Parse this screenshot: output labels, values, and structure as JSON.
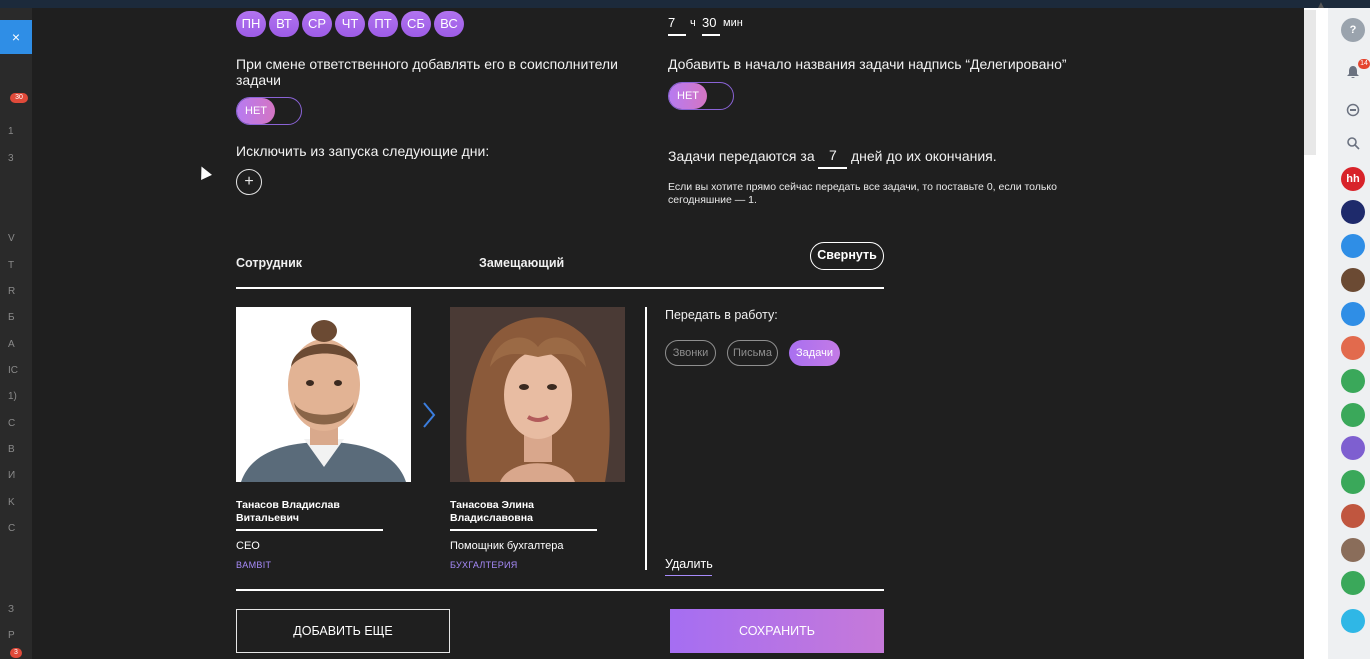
{
  "side": {
    "close_icon": "×",
    "letters": [
      "1",
      "3",
      "V",
      "T",
      "R",
      "Б",
      "A",
      "IC",
      "1)",
      "C",
      "B",
      "И",
      "K",
      "C",
      "З",
      "P"
    ],
    "badge_top": "30",
    "badge_bottom": "3"
  },
  "schedule": {
    "days": [
      "ПН",
      "ВТ",
      "СР",
      "ЧТ",
      "ПТ",
      "СБ",
      "ВС"
    ],
    "time_hours": "7",
    "hours_unit": "ч",
    "time_minutes": "30",
    "minutes_unit": "мин"
  },
  "settings": {
    "add_coexecutor_label": "При смене ответственного добавлять его в соисполнители задачи",
    "add_coexecutor_value": "НЕТ",
    "prefix_label": "Добавить в начало названия задачи надпись “Делегировано”",
    "prefix_value": "НЕТ",
    "exclude_days_label": "Исключить из запуска следующие дни:",
    "add_icon": "+",
    "days_before_prefix": "Задачи передаются за",
    "days_before_value": "7",
    "days_before_suffix": "дней до их окончания.",
    "note": "Если вы хотите прямо сейчас передать все задачи, то поставьте 0, если только сегодняшние — 1."
  },
  "table": {
    "employee_header": "Сотрудник",
    "substitute_header": "Замещающий",
    "collapse_label": "Свернуть"
  },
  "employee": {
    "name": "Танасов Владислав Витальевич",
    "role": "CEO",
    "department": "BAMBIT"
  },
  "substitute": {
    "name": "Танасова Элина Владиславовна",
    "role": "Помощник бухгалтера",
    "department": "БУХГАЛТЕРИЯ"
  },
  "transfer": {
    "label": "Передать в работу:",
    "chips": [
      {
        "label": "Звонки",
        "active": false
      },
      {
        "label": "Письма",
        "active": false
      },
      {
        "label": "Задачи",
        "active": true
      }
    ],
    "delete_label": "Удалить"
  },
  "actions": {
    "add_more_label": "ДОБАВИТЬ ЕЩЕ",
    "save_label": "СОХРАНИТЬ"
  },
  "rightbar": {
    "help_icon": "?",
    "notifications_badge": "14",
    "hh_label": "hh"
  },
  "colors": {
    "background": "#1f1f1f",
    "accent": "#a56ef2",
    "department": "#a78bfa"
  }
}
